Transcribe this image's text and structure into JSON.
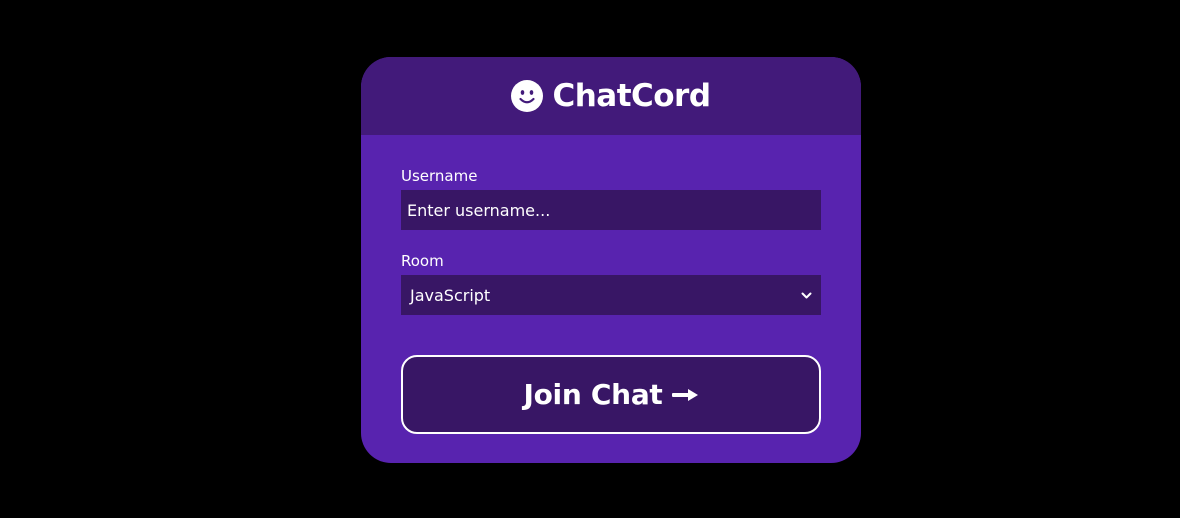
{
  "app": {
    "title": "ChatCord",
    "logo_icon": "smiley-face-icon"
  },
  "form": {
    "username": {
      "label": "Username",
      "placeholder": "Enter username...",
      "value": ""
    },
    "room": {
      "label": "Room",
      "selected": "JavaScript",
      "dropdown_icon": "chevron-down-icon"
    },
    "submit": {
      "label": "Join Chat",
      "icon": "arrow-right-icon"
    }
  },
  "colors": {
    "page_background": "#000000",
    "card_background": "#5823af",
    "header_background": "#421a7a",
    "field_background": "#381665",
    "text": "#ffffff"
  }
}
